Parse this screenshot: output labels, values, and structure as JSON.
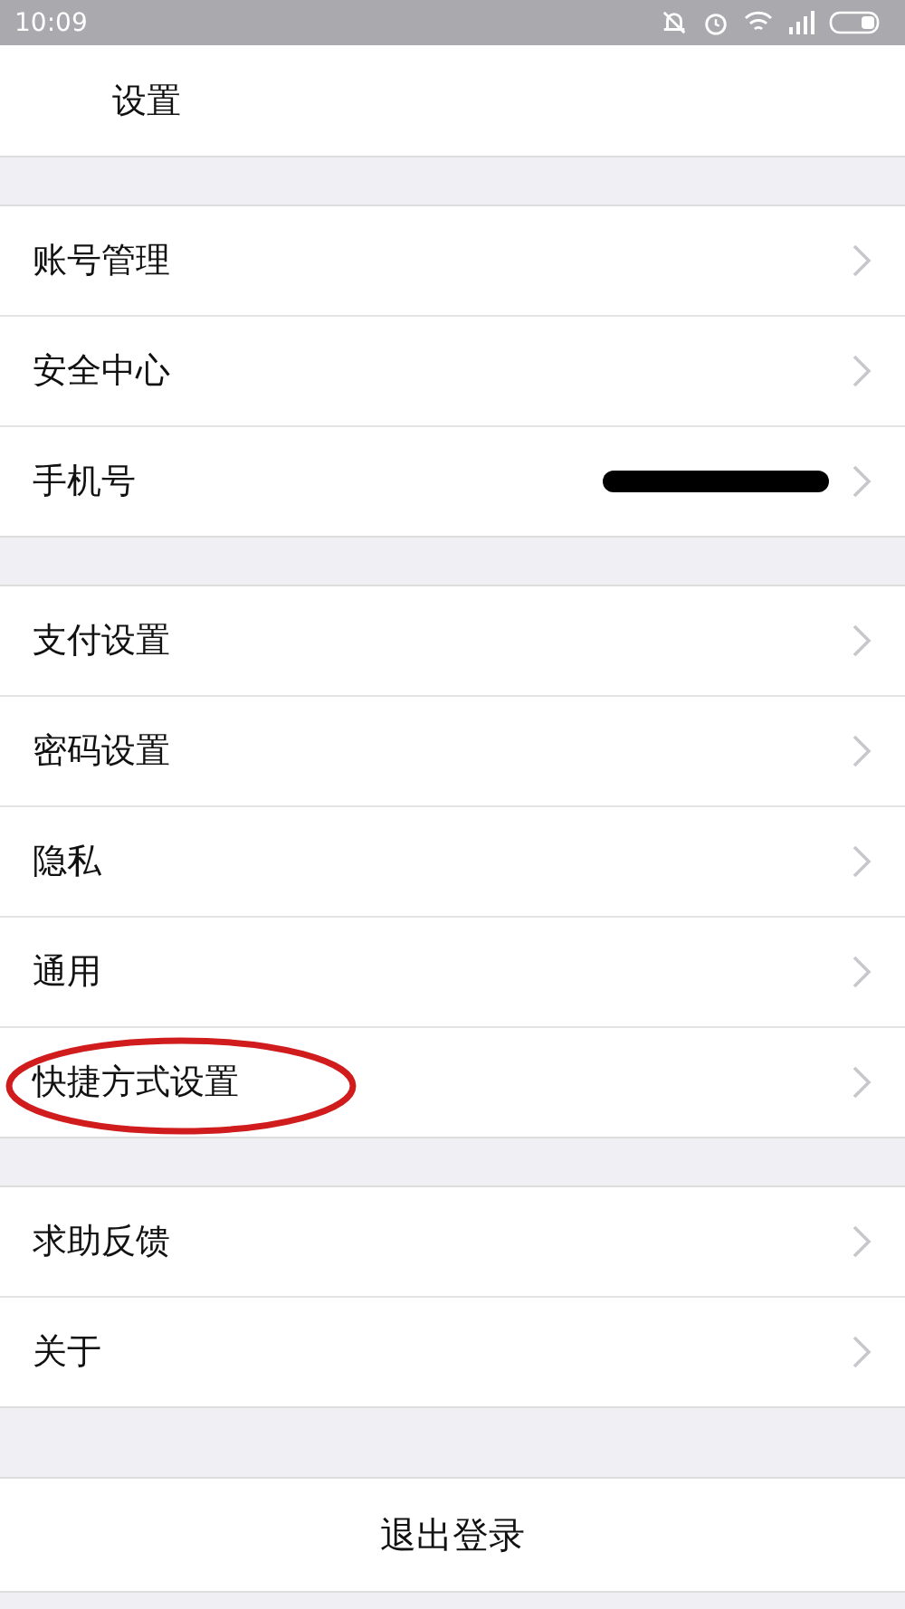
{
  "status_bar": {
    "time": "10:09"
  },
  "header": {
    "title": "设置"
  },
  "sections": [
    {
      "rows": [
        {
          "label": "账号管理",
          "kind": "plain",
          "circled": false
        },
        {
          "label": "安全中心",
          "kind": "plain",
          "circled": false
        },
        {
          "label": "手机号",
          "kind": "redacted",
          "circled": false
        }
      ]
    },
    {
      "rows": [
        {
          "label": "支付设置",
          "kind": "plain",
          "circled": false
        },
        {
          "label": "密码设置",
          "kind": "plain",
          "circled": false
        },
        {
          "label": "隐私",
          "kind": "plain",
          "circled": false
        },
        {
          "label": "通用",
          "kind": "plain",
          "circled": false
        },
        {
          "label": "快捷方式设置",
          "kind": "plain",
          "circled": true
        }
      ]
    },
    {
      "rows": [
        {
          "label": "求助反馈",
          "kind": "plain",
          "circled": false
        },
        {
          "label": "关于",
          "kind": "plain",
          "circled": false
        }
      ]
    }
  ],
  "logout_button": "退出登录"
}
